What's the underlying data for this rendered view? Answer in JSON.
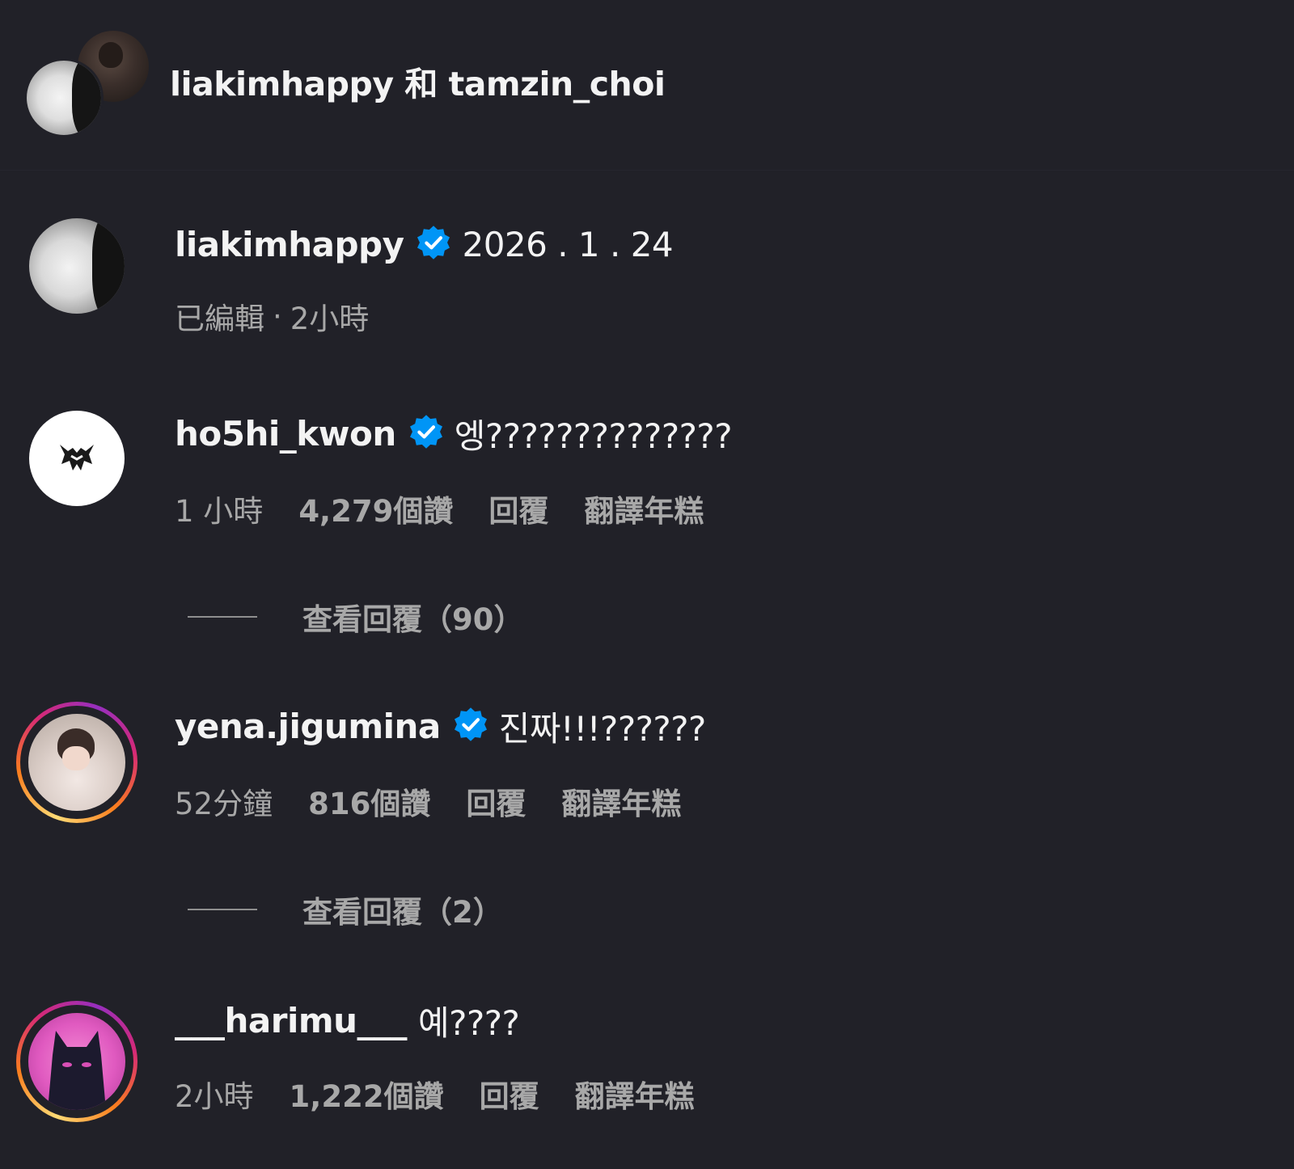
{
  "header": {
    "title": "liakimhappy 和 tamzin_choi"
  },
  "caption": {
    "username": "liakimhappy",
    "text": "2026 . 1 . 24",
    "edited": "已編輯",
    "separator": "·",
    "time": "2小時"
  },
  "comments": [
    {
      "username": "ho5hi_kwon",
      "verified": true,
      "text": "엥??????????????",
      "time": "1 小時",
      "likes": "4,279個讚",
      "reply_label": "回覆",
      "translate_label": "翻譯年糕",
      "view_replies": "查看回覆（90）"
    },
    {
      "username": "yena.jigumina",
      "verified": true,
      "text": "진짜!!!??????",
      "time": "52分鐘",
      "likes": "816個讚",
      "reply_label": "回覆",
      "translate_label": "翻譯年糕",
      "view_replies": "查看回覆（2）"
    },
    {
      "username": "___harimu___",
      "verified": false,
      "text": "예????",
      "time": "2小時",
      "likes": "1,222個讚",
      "reply_label": "回覆",
      "translate_label": "翻譯年糕"
    }
  ],
  "colors": {
    "background": "#212128",
    "verified_badge": "#0095f6",
    "primary_text": "#f3f3f3",
    "secondary_text": "#a8a8a8"
  },
  "icons": {
    "verified": "verified-badge-icon"
  }
}
